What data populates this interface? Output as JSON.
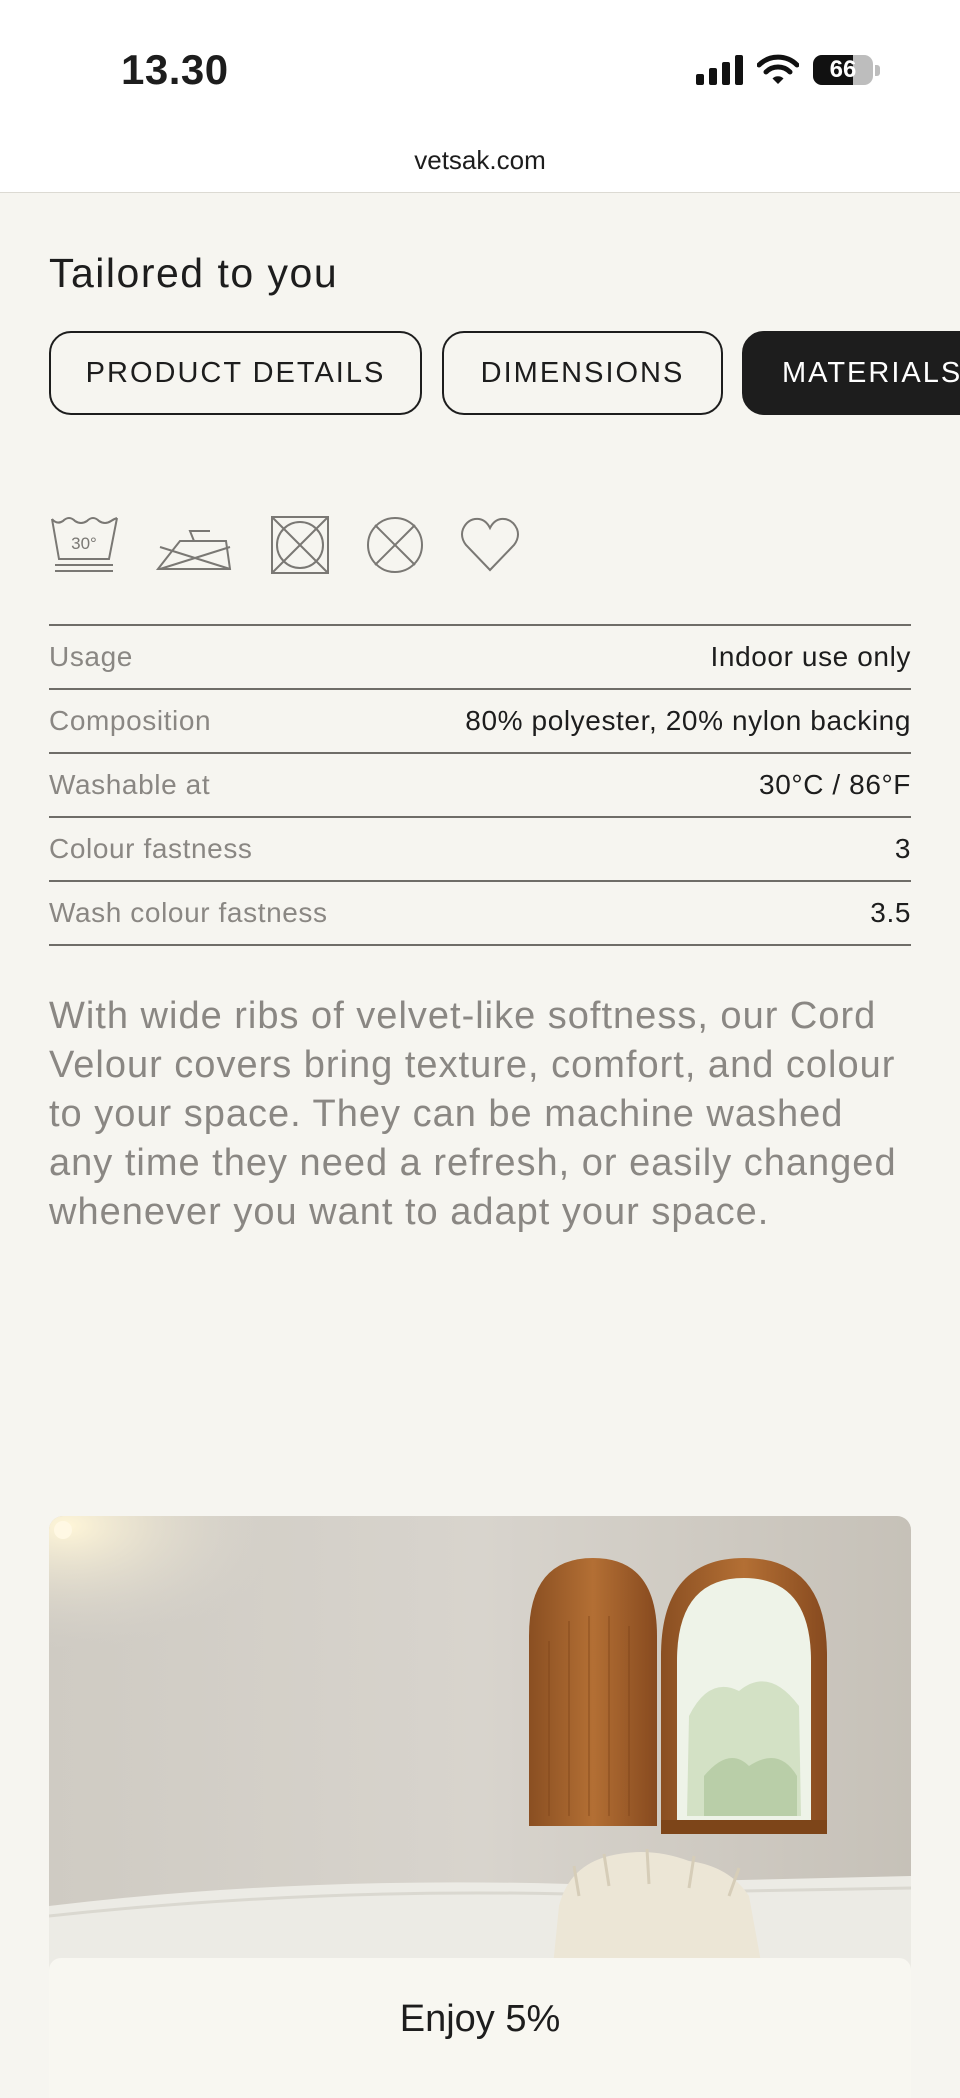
{
  "status_bar": {
    "time": "13.30",
    "battery": "66",
    "battery_level": 0.66
  },
  "browser": {
    "url": "vetsak.com"
  },
  "section": {
    "title": "Tailored to you"
  },
  "tabs": [
    {
      "label": "PRODUCT DETAILS",
      "active": false
    },
    {
      "label": "DIMENSIONS",
      "active": false
    },
    {
      "label": "MATERIALS",
      "active": true
    }
  ],
  "care_icons": [
    {
      "name": "wash-30-icon",
      "text": "30°"
    },
    {
      "name": "do-not-iron-icon"
    },
    {
      "name": "do-not-tumble-dry-icon"
    },
    {
      "name": "do-not-dry-clean-icon"
    },
    {
      "name": "heart-icon"
    }
  ],
  "specs": [
    {
      "label": "Usage",
      "value": "Indoor use only"
    },
    {
      "label": "Composition",
      "value": "80% polyester, 20% nylon backing"
    },
    {
      "label": "Washable at",
      "value": "30°C / 86°F"
    },
    {
      "label": "Colour fastness",
      "value": "3"
    },
    {
      "label": "Wash colour fastness",
      "value": "3.5"
    }
  ],
  "description": "With wide ribs of velvet-like softness, our Cord Velour covers bring texture, comfort, and colour to your space. They can be machine washed any time they need a refresh, or easily changed whenever you want to adapt your space.",
  "promo": {
    "text": "Enjoy 5%"
  }
}
